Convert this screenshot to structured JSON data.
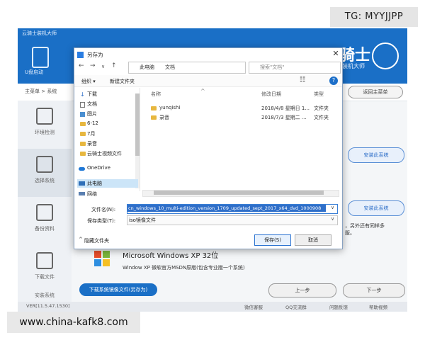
{
  "watermarks": {
    "tg": "TG: MYYJJPP",
    "url": "www.china-kafk8.com"
  },
  "app": {
    "title": "云骑士装机大师",
    "usb_label": "U盘启动",
    "brand": "骑士",
    "brand_sub": "装机大师",
    "breadcrumb": "主菜单  >  系统",
    "back_button": "返回主菜单",
    "sidebar": [
      {
        "label": "环境检测",
        "icon": "monitor-icon"
      },
      {
        "label": "选择系统",
        "icon": "cursor-icon"
      },
      {
        "label": "备份资料",
        "icon": "list-icon"
      },
      {
        "label": "下载文件",
        "icon": "download-icon"
      },
      {
        "label": "安装系统",
        "icon": "wrench-icon"
      }
    ],
    "install_button_1": "安装此系统",
    "install_button_2": "安装此系统",
    "ghost_text": "，另外还有同样多",
    "ghost_text2": "版。",
    "xp_title": "Microsoft Windows XP 32位",
    "xp_desc": "Window XP 微软官方MSDN原版(包含专业版一个系统)",
    "download_button": "下载系统镜像文件(另存为)",
    "prev_button": "上一步",
    "next_button": "下一步",
    "version": "VER[11.5.47.1530]",
    "status_items": [
      "微信客服",
      "QQ交流群",
      "问题反馈",
      "帮助视频"
    ]
  },
  "dialog": {
    "title": "另存为",
    "address": [
      "此电脑",
      "文档"
    ],
    "search_placeholder": "搜索\"文档\"",
    "organize": "组织 ▾",
    "new_folder": "新建文件夹",
    "view_icon": "view-icon",
    "help": "?",
    "nav_items": [
      "下载",
      "文档",
      "图片",
      "6-12",
      "7月",
      "录音",
      "云骑士视频文件",
      "OneDrive",
      "此电脑",
      "网络"
    ],
    "columns": {
      "name": "名称",
      "date": "修改日期",
      "type": "类型"
    },
    "files": [
      {
        "name": "yunqishi",
        "date": "2018/4/8 星期日 1...",
        "type": "文件夹"
      },
      {
        "name": "录音",
        "date": "2018/7/3 星期二 ...",
        "type": "文件夹"
      }
    ],
    "filename_label": "文件名(N):",
    "filename_value": "cn_windows_10_multi-edition_version_1709_updated_sept_2017_x64_dvd_1000908",
    "filetype_label": "保存类型(T):",
    "filetype_value": "iso镜像文件",
    "hide_folders": "隐藏文件夹",
    "save_button": "保存(S)",
    "cancel_button": "取消"
  }
}
